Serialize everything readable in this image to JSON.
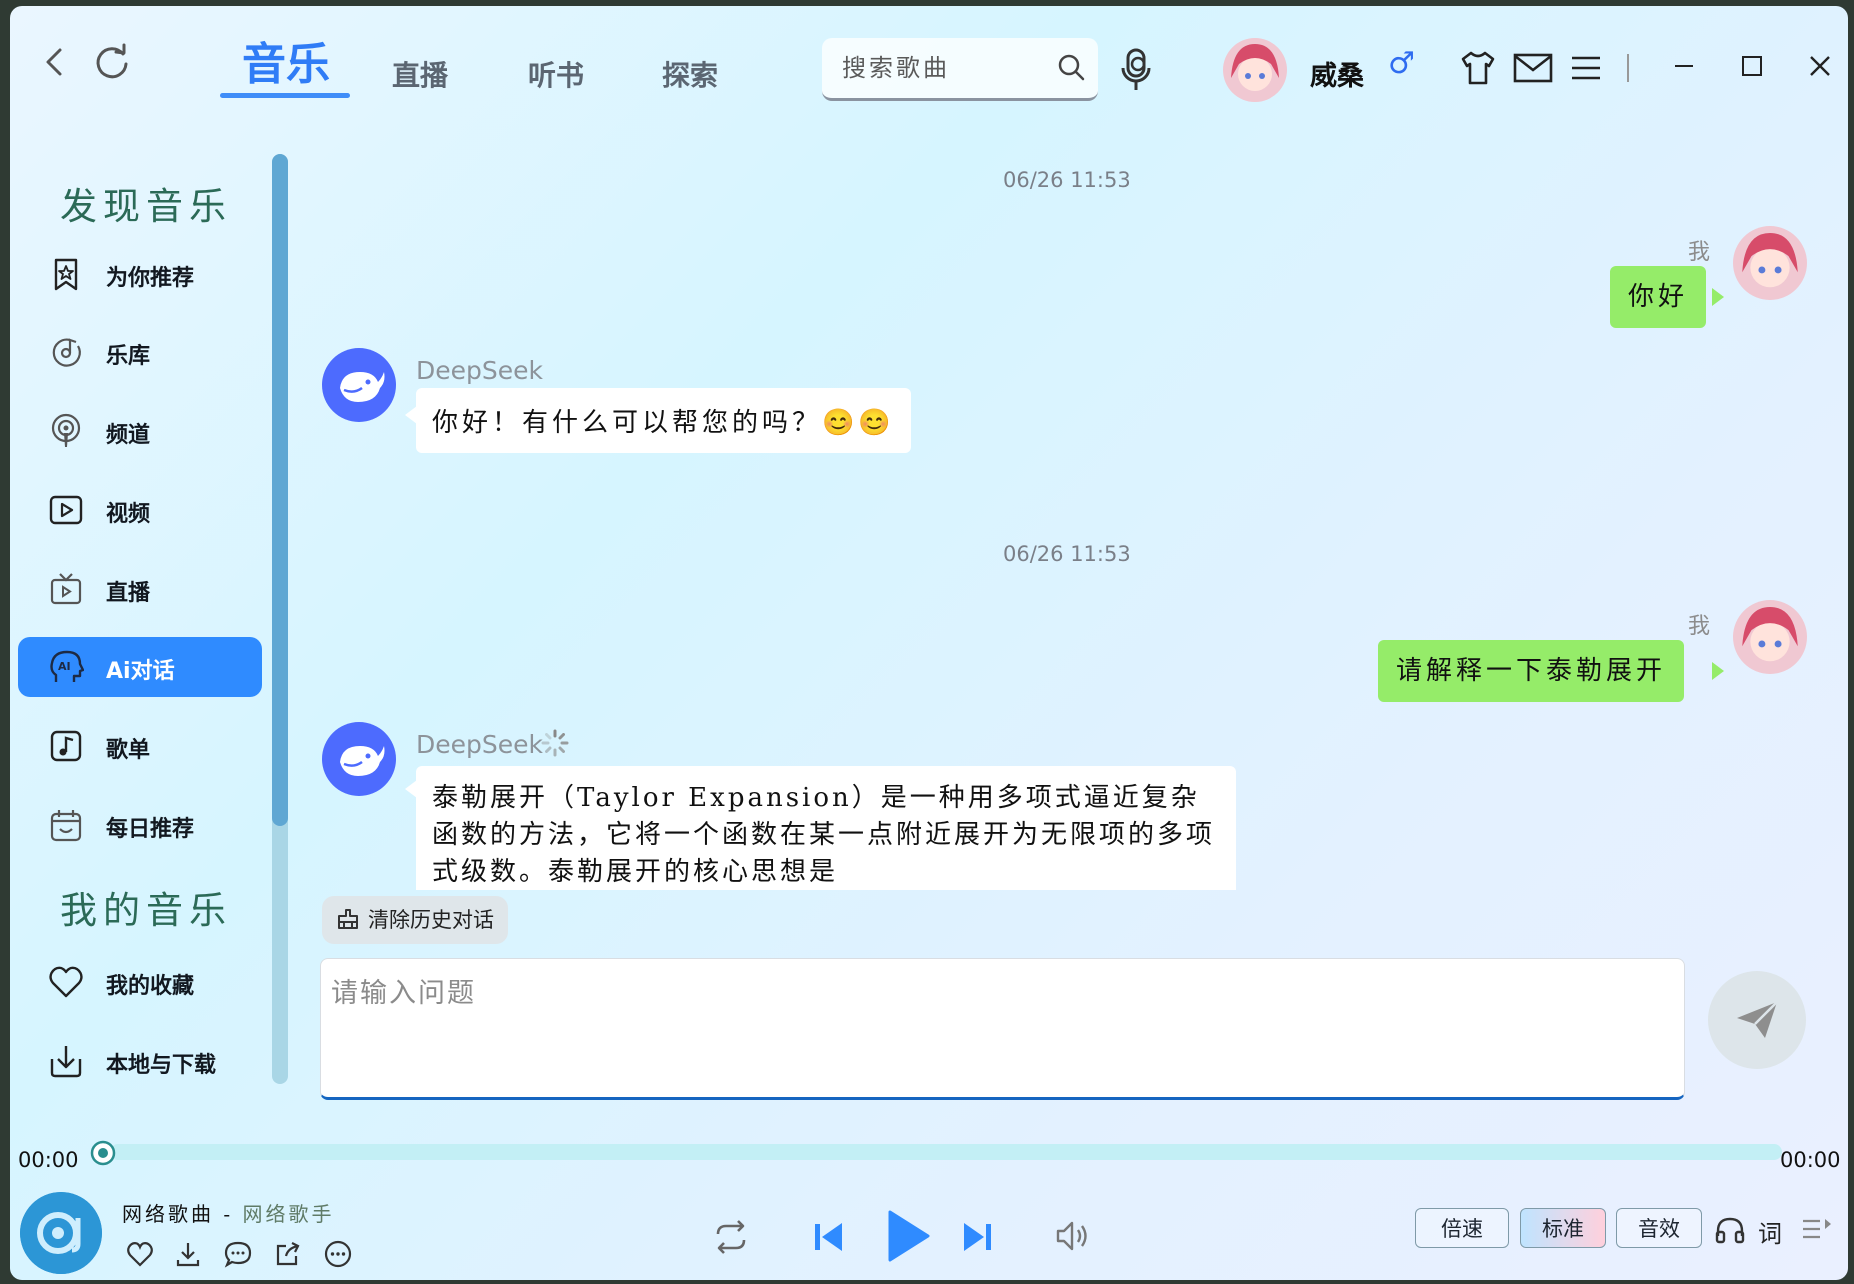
{
  "topbar": {
    "tabs": [
      {
        "label": "音乐",
        "active": true
      },
      {
        "label": "直播",
        "active": false
      },
      {
        "label": "听书",
        "active": false
      },
      {
        "label": "探索",
        "active": false
      }
    ],
    "search_placeholder": "搜索歌曲",
    "user_name": "威桑",
    "gender_symbol": "♂"
  },
  "sidebar": {
    "discover_title": "发现音乐",
    "discover_items": [
      {
        "label": "为你推荐",
        "icon": "star-bookmark-icon"
      },
      {
        "label": "乐库",
        "icon": "music-disc-icon"
      },
      {
        "label": "频道",
        "icon": "podcast-icon"
      },
      {
        "label": "视频",
        "icon": "video-play-icon"
      },
      {
        "label": "直播",
        "icon": "tv-icon"
      },
      {
        "label": "Ai对话",
        "icon": "ai-head-icon",
        "active": true
      },
      {
        "label": "歌单",
        "icon": "playlist-note-icon"
      },
      {
        "label": "每日推荐",
        "icon": "calendar-icon"
      }
    ],
    "mine_title": "我的音乐",
    "mine_items": [
      {
        "label": "我的收藏",
        "icon": "heart-icon"
      },
      {
        "label": "本地与下载",
        "icon": "download-icon"
      }
    ]
  },
  "chat": {
    "messages": [
      {
        "timestamp": "06/26 11:53",
        "user_name": "我",
        "user_text": "你好",
        "bot_name": "DeepSeek",
        "bot_text": "你好！有什么可以帮您的吗？😊😊"
      },
      {
        "timestamp": "06/26 11:53",
        "user_name": "我",
        "user_text": "请解释一下泰勒展开",
        "bot_name": "DeepSeek",
        "bot_text": "泰勒展开（Taylor Expansion）是一种用多项式逼近复杂函数的方法，它将一个函数在某一点附近展开为无限项的多项式级数。泰勒展开的核心思想是"
      }
    ],
    "clear_history_label": "清除历史对话",
    "input_placeholder": "请输入问题"
  },
  "player": {
    "time_current": "00:00",
    "time_total": "00:00",
    "progress": 0,
    "song_name": "网络歌曲",
    "separator": " - ",
    "artist_name": "网络歌手",
    "speed_label": "倍速",
    "quality_label": "标准",
    "effects_label": "音效",
    "lyrics_label": "词"
  },
  "colors": {
    "accent": "#2f8bff",
    "user_bubble": "#95ec69",
    "bot_avatar": "#4d6bfe",
    "section_title": "#2b6a57"
  }
}
